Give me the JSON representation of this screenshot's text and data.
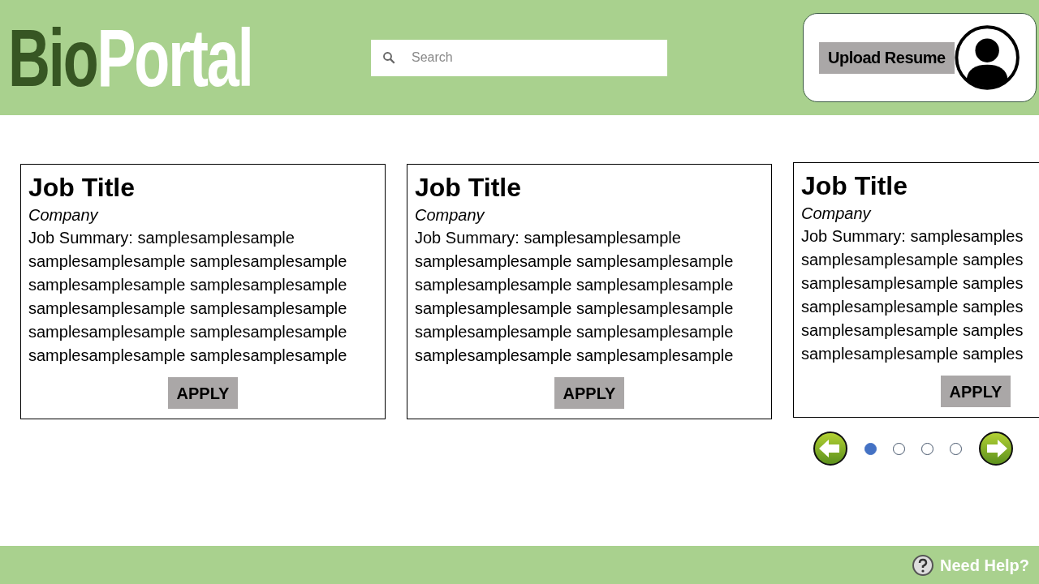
{
  "header": {
    "logo": {
      "dark_part": "Bio",
      "light_part": "Portal"
    },
    "search": {
      "placeholder": "Search"
    },
    "upload_button": "Upload Resume"
  },
  "jobs": [
    {
      "title": "Job Title",
      "company": "Company",
      "summary_lines": [
        "Job Summary: samplesamplesample",
        "samplesamplesample samplesamplesample",
        "samplesamplesample samplesamplesample",
        "samplesamplesample samplesamplesample",
        "samplesamplesample samplesamplesample",
        "samplesamplesample samplesamplesample"
      ],
      "button": "APPLY"
    },
    {
      "title": "Job Title",
      "company": "Company",
      "summary_lines": [
        "Job Summary: samplesamplesample",
        "samplesamplesample samplesamplesample",
        "samplesamplesample samplesamplesample",
        "samplesamplesample samplesamplesample",
        "samplesamplesample samplesamplesample",
        "samplesamplesample samplesamplesample"
      ],
      "button": "APPLY"
    },
    {
      "title": "Job Title",
      "company": "Company",
      "summary_lines": [
        "Job Summary: samplesamples",
        "samplesamplesample samples",
        "samplesamplesample samples",
        "samplesamplesample samples",
        "samplesamplesample samples",
        "samplesamplesample samples"
      ],
      "button": "APPLY"
    }
  ],
  "pagination": {
    "dots": [
      {
        "selected": true
      },
      {
        "selected": false
      },
      {
        "selected": false
      },
      {
        "selected": false
      }
    ]
  },
  "footer": {
    "help_link": "Need Help?"
  }
}
